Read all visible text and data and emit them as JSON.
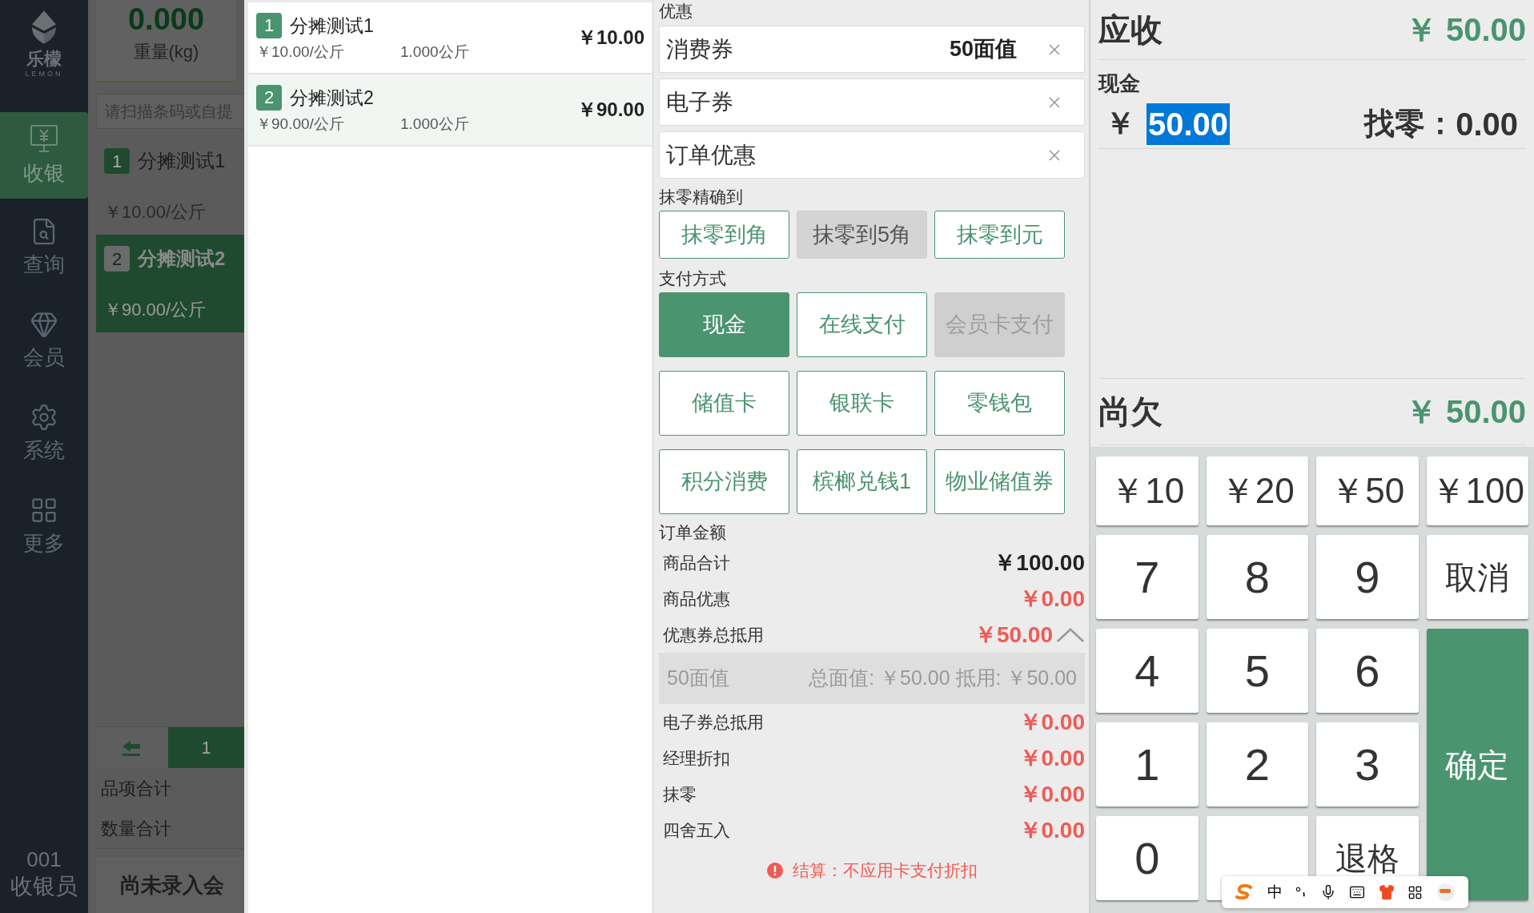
{
  "sidebar": {
    "logo": {
      "name": "乐檬",
      "subtitle": "LEMON"
    },
    "items": [
      {
        "label": "收银",
        "selected": true
      },
      {
        "label": "查询",
        "selected": false
      },
      {
        "label": "会员",
        "selected": false
      },
      {
        "label": "系统",
        "selected": false
      },
      {
        "label": "更多",
        "selected": false
      }
    ],
    "user": {
      "id": "001",
      "role": "收银员"
    }
  },
  "cart_panel": {
    "weight": "0.000",
    "weight_label": "重量(kg)",
    "search": {
      "placeholder": "请扫描条码或自提"
    },
    "items": [
      {
        "index": "1",
        "name": "分摊测试1",
        "price": "￥10.00/公斤",
        "selected": false
      },
      {
        "index": "2",
        "name": "分摊测试2",
        "price": "￥90.00/公斤",
        "selected": true
      }
    ],
    "pager": {
      "page": "1"
    },
    "summary": [
      {
        "label": "品项合计"
      },
      {
        "label": "数量合计"
      }
    ],
    "member": "尚未录入会"
  },
  "order_items": [
    {
      "index": "1",
      "name": "分摊测试1",
      "unit_price": "￥10.00/公斤",
      "quantity": "1.000公斤",
      "amount": "￥10.00",
      "selected": false
    },
    {
      "index": "2",
      "name": "分摊测试2",
      "unit_price": "￥90.00/公斤",
      "quantity": "1.000公斤",
      "amount": "￥90.00",
      "selected": true
    }
  ],
  "discounts": {
    "title": "优惠",
    "fields": [
      {
        "label": "消费券",
        "value": "50面值"
      },
      {
        "label": "电子券"
      },
      {
        "label": "订单优惠"
      }
    ]
  },
  "rounding": {
    "title": "抹零精确到",
    "options": [
      {
        "label": "抹零到角",
        "selected": false
      },
      {
        "label": "抹零到5角",
        "selected": true
      },
      {
        "label": "抹零到元",
        "selected": false
      }
    ]
  },
  "payment_methods": {
    "title": "支付方式",
    "options": [
      {
        "label": "现金",
        "selected": true,
        "disabled": false
      },
      {
        "label": "在线支付",
        "selected": false,
        "disabled": false
      },
      {
        "label": "会员卡支付",
        "selected": false,
        "disabled": true
      },
      {
        "label": "储值卡",
        "selected": false,
        "disabled": false
      },
      {
        "label": "银联卡",
        "selected": false,
        "disabled": false
      },
      {
        "label": "零钱包",
        "selected": false,
        "disabled": false
      },
      {
        "label": "积分消费",
        "selected": false,
        "disabled": false
      },
      {
        "label": "槟榔兑钱1",
        "selected": false,
        "disabled": false
      },
      {
        "label": "物业储值券",
        "selected": false,
        "disabled": false
      }
    ]
  },
  "order_amount": {
    "title": "订单金额",
    "rows": [
      {
        "label": "商品合计",
        "value": "￥100.00",
        "kind": "total"
      },
      {
        "label": "商品优惠",
        "value": "￥0.00",
        "kind": "discount"
      },
      {
        "label": "优惠券总抵用",
        "value": "￥50.00",
        "kind": "discount",
        "expanded": true,
        "details": [
          {
            "name": "50面值",
            "text": "总面值: ￥50.00 抵用: ￥50.00"
          }
        ]
      },
      {
        "label": "电子券总抵用",
        "value": "￥0.00",
        "kind": "discount"
      },
      {
        "label": "经理折扣",
        "value": "￥0.00",
        "kind": "discount"
      },
      {
        "label": "抹零",
        "value": "￥0.00",
        "kind": "discount"
      },
      {
        "label": "四舍五入",
        "value": "￥0.00",
        "kind": "discount"
      }
    ],
    "notice": "结算：不应用卡支付折扣"
  },
  "receivable": {
    "label": "应收",
    "value": "￥ 50.00"
  },
  "cash": {
    "label": "现金",
    "currency": "￥",
    "value": "50.00",
    "change_label": "找零：",
    "change": "0.00"
  },
  "outstanding": {
    "label": "尚欠",
    "value": "￥ 50.00"
  },
  "keypad": [
    {
      "label": "￥10",
      "kind": "cash"
    },
    {
      "label": "￥20",
      "kind": "cash"
    },
    {
      "label": "￥50",
      "kind": "cash"
    },
    {
      "label": "￥100",
      "kind": "cash"
    },
    {
      "label": "7",
      "kind": "key"
    },
    {
      "label": "8",
      "kind": "key"
    },
    {
      "label": "9",
      "kind": "key"
    },
    {
      "label": "取消",
      "kind": "command"
    },
    {
      "label": "4",
      "kind": "key"
    },
    {
      "label": "5",
      "kind": "key"
    },
    {
      "label": "6",
      "kind": "key"
    },
    {
      "label": "1",
      "kind": "key"
    },
    {
      "label": "2",
      "kind": "key"
    },
    {
      "label": "3",
      "kind": "key"
    },
    {
      "label": "确定",
      "kind": "confirm"
    },
    {
      "label": "0",
      "kind": "key"
    },
    {
      "kind": "blank"
    },
    {
      "label": "退格",
      "kind": "command"
    }
  ],
  "ime_toolbar": {
    "mode": "中"
  }
}
